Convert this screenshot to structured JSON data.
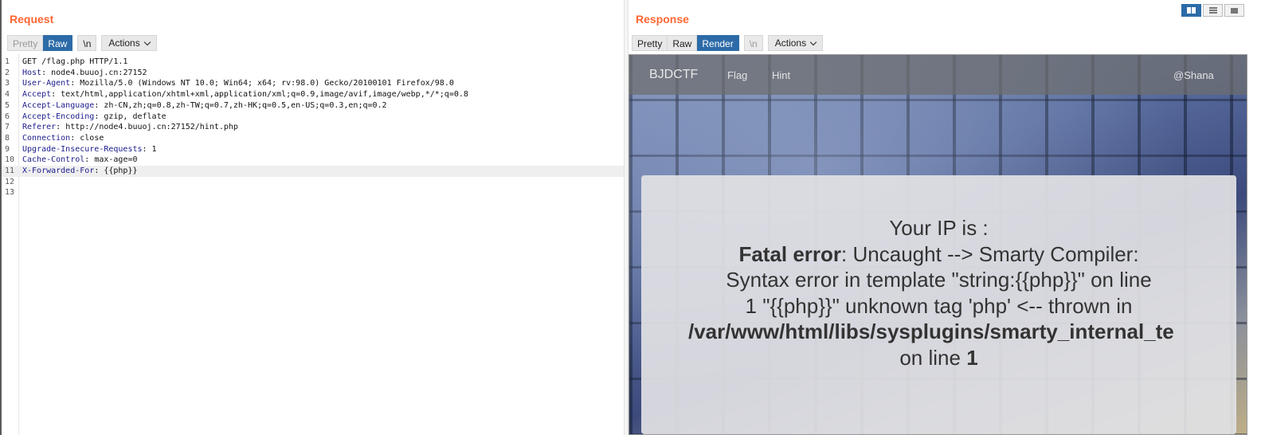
{
  "request": {
    "title": "Request",
    "tabs": {
      "pretty": "Pretty",
      "raw": "Raw",
      "newline": "\\n",
      "actions": "Actions"
    },
    "lines": [
      {
        "num": "1",
        "header": "",
        "value": "GET /flag.php HTTP/1.1"
      },
      {
        "num": "2",
        "header": "Host",
        "value": ": node4.buuoj.cn:27152"
      },
      {
        "num": "3",
        "header": "User-Agent",
        "value": ": Mozilla/5.0 (Windows NT 10.0; Win64; x64; rv:98.0) Gecko/20100101 Firefox/98.0"
      },
      {
        "num": "4",
        "header": "Accept",
        "value": ": text/html,application/xhtml+xml,application/xml;q=0.9,image/avif,image/webp,*/*;q=0.8"
      },
      {
        "num": "5",
        "header": "Accept-Language",
        "value": ": zh-CN,zh;q=0.8,zh-TW;q=0.7,zh-HK;q=0.5,en-US;q=0.3,en;q=0.2"
      },
      {
        "num": "6",
        "header": "Accept-Encoding",
        "value": ": gzip, deflate"
      },
      {
        "num": "7",
        "header": "Referer",
        "value": ": http://node4.buuoj.cn:27152/hint.php"
      },
      {
        "num": "8",
        "header": "Connection",
        "value": ": close"
      },
      {
        "num": "9",
        "header": "Upgrade-Insecure-Requests",
        "value": ": 1"
      },
      {
        "num": "10",
        "header": "Cache-Control",
        "value": ": max-age=0"
      },
      {
        "num": "11",
        "header": "X-Forwarded-For",
        "value": ": {{php}}"
      },
      {
        "num": "12",
        "header": "",
        "value": ""
      },
      {
        "num": "13",
        "header": "",
        "value": ""
      }
    ]
  },
  "response": {
    "title": "Response",
    "tabs": {
      "pretty": "Pretty",
      "raw": "Raw",
      "render": "Render",
      "newline": "\\n",
      "actions": "Actions"
    },
    "rendered": {
      "brand": "BJDCTF",
      "nav": [
        "Flag",
        "Hint"
      ],
      "user": "@Shana",
      "ip_label": "Your IP is :",
      "fatal_label": "Fatal error",
      "line1_rest": ": Uncaught --> Smarty Compiler:",
      "line2": "Syntax error in template \"string:{{php}}\" on line",
      "line3": "1 \"{{php}}\" unknown tag 'php' <-- thrown in",
      "path": "/var/www/html/libs/sysplugins/smarty_internal_te",
      "on_line": "on line ",
      "line_num": "1"
    }
  },
  "layout_toggle": {
    "selected": "side-by-side"
  },
  "colors": {
    "accent": "#ff6633",
    "active_tab": "#2c6ba8",
    "header_name": "#1b1b8c"
  }
}
